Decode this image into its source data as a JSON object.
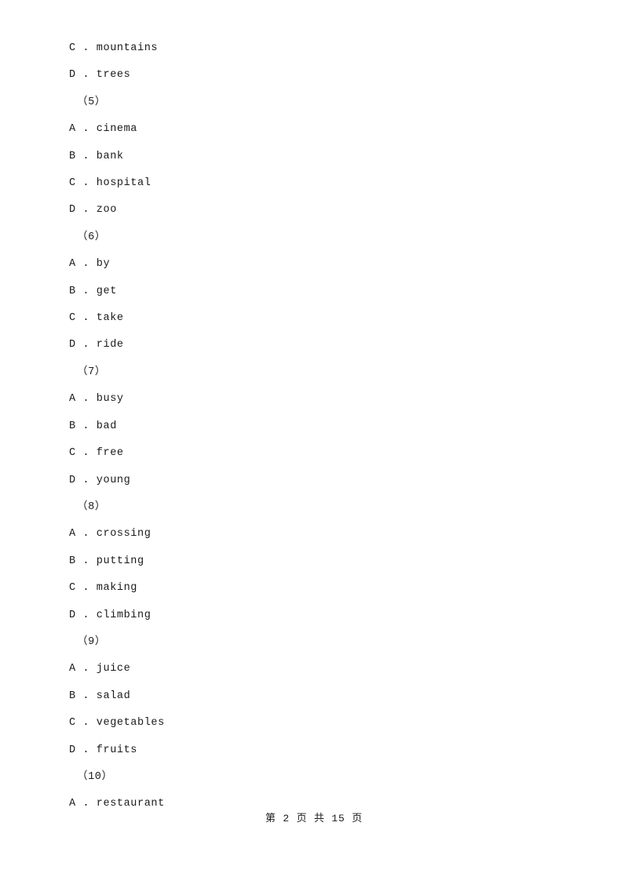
{
  "page": {
    "lines": [
      {
        "text": "C . mountains",
        "type": "option"
      },
      {
        "text": "D . trees",
        "type": "option"
      },
      {
        "text": "（5）",
        "type": "group"
      },
      {
        "text": "A . cinema",
        "type": "option"
      },
      {
        "text": "B . bank",
        "type": "option"
      },
      {
        "text": "C . hospital",
        "type": "option"
      },
      {
        "text": "D . zoo",
        "type": "option"
      },
      {
        "text": "（6）",
        "type": "group"
      },
      {
        "text": "A . by",
        "type": "option"
      },
      {
        "text": "B . get",
        "type": "option"
      },
      {
        "text": "C . take",
        "type": "option"
      },
      {
        "text": "D . ride",
        "type": "option"
      },
      {
        "text": "（7）",
        "type": "group"
      },
      {
        "text": "A . busy",
        "type": "option"
      },
      {
        "text": "B . bad",
        "type": "option"
      },
      {
        "text": "C . free",
        "type": "option"
      },
      {
        "text": "D . young",
        "type": "option"
      },
      {
        "text": "（8）",
        "type": "group"
      },
      {
        "text": "A . crossing",
        "type": "option"
      },
      {
        "text": "B . putting",
        "type": "option"
      },
      {
        "text": "C . making",
        "type": "option"
      },
      {
        "text": "D . climbing",
        "type": "option"
      },
      {
        "text": "（9）",
        "type": "group"
      },
      {
        "text": "A . juice",
        "type": "option"
      },
      {
        "text": "B . salad",
        "type": "option"
      },
      {
        "text": "C . vegetables",
        "type": "option"
      },
      {
        "text": "D . fruits",
        "type": "option"
      },
      {
        "text": "（10）",
        "type": "group"
      },
      {
        "text": "A . restaurant",
        "type": "option"
      }
    ],
    "footer": "第 2 页 共 15 页"
  }
}
